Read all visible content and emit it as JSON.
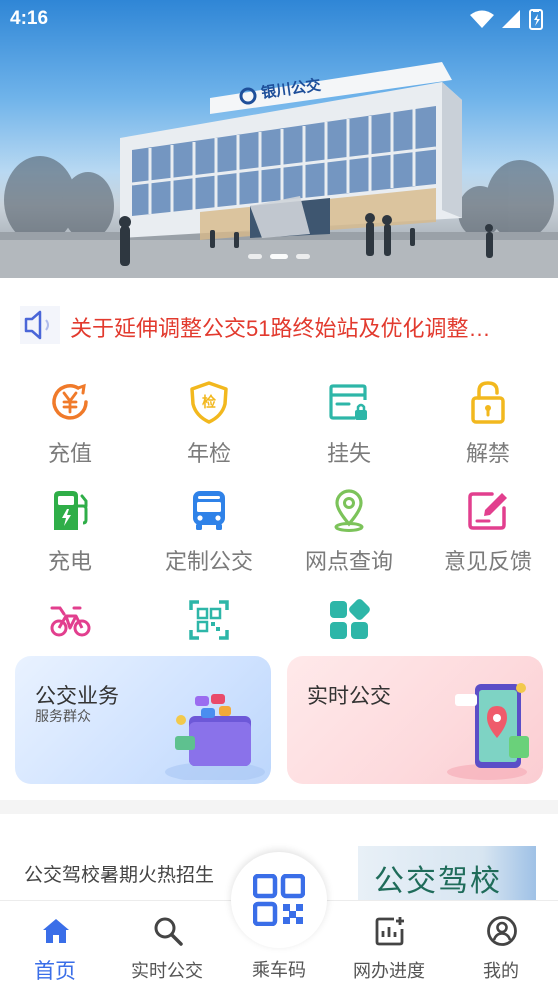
{
  "status_bar": {
    "time": "4:16"
  },
  "notice": {
    "text": "关于延伸调整公交51路终始站及优化调整…",
    "color": "#e23a2e"
  },
  "hero": {
    "sign_text": "银川公交"
  },
  "grid": {
    "items": [
      {
        "label": "充值",
        "icon": "yen-icon",
        "color": "#f07a2a"
      },
      {
        "label": "年检",
        "icon": "inspection-shield-icon",
        "color": "#f2b81e"
      },
      {
        "label": "挂失",
        "icon": "card-lock-icon",
        "color": "#2db6a8"
      },
      {
        "label": "解禁",
        "icon": "unlock-icon",
        "color": "#f2b81e"
      },
      {
        "label": "充电",
        "icon": "charging-station-icon",
        "color": "#2fae48"
      },
      {
        "label": "定制公交",
        "icon": "bus-icon",
        "color": "#2f82e8"
      },
      {
        "label": "网点查询",
        "icon": "location-pin-icon",
        "color": "#7cc35a"
      },
      {
        "label": "意见反馈",
        "icon": "feedback-edit-icon",
        "color": "#e23f8e"
      },
      {
        "label": "",
        "icon": "bike-icon",
        "color": "#e23f8e"
      },
      {
        "label": "",
        "icon": "qr-scan-icon",
        "color": "#2db6a8"
      },
      {
        "label": "",
        "icon": "apps-grid-icon",
        "color": "#2db6a8"
      }
    ]
  },
  "cards": {
    "bus_business": {
      "title": "公交业务",
      "subtitle": "服务群众"
    },
    "realtime_bus": {
      "title": "实时公交"
    }
  },
  "promo": {
    "text": "公交驾校暑期火热招生",
    "image_text": "公交驾校"
  },
  "bottom_nav": {
    "home": "首页",
    "realtime": "实时公交",
    "ride_code": "乘车码",
    "progress": "网办进度",
    "mine": "我的",
    "active_color": "#3a6ee8"
  }
}
